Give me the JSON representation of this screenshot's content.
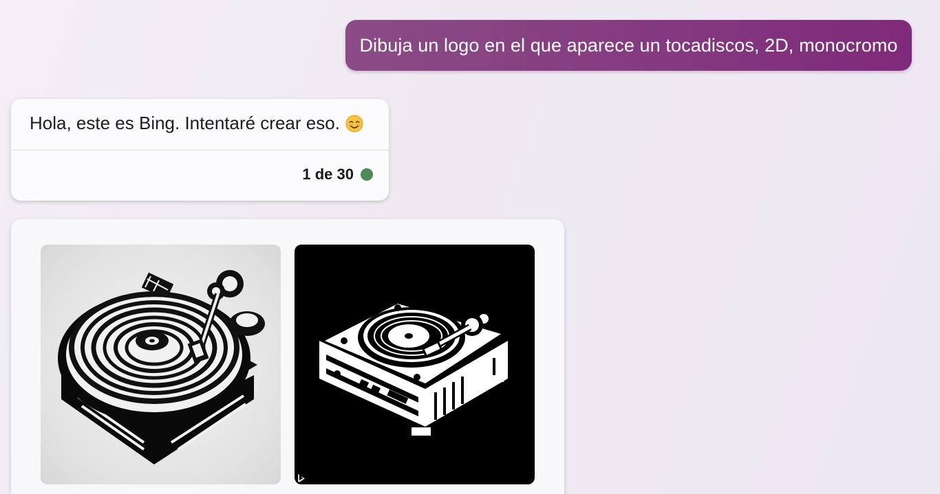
{
  "user_message": {
    "text": "Dibuja un logo en el que aparece un tocadiscos, 2D, monocromo"
  },
  "bot_message": {
    "text": "Hola, este es Bing. Intentaré crear eso.",
    "emoji": "smiling-face-icon",
    "counter": "1 de 30",
    "status_color": "#4d8a56"
  },
  "generated_images": {
    "items": [
      {
        "name": "turntable-logo-1",
        "style": "black ink on light grey"
      },
      {
        "name": "turntable-logo-2",
        "style": "white on black"
      }
    ]
  },
  "colors": {
    "user_bubble": "#84387f",
    "card_background": "#fbfafc",
    "page_background": "#efeaf2"
  }
}
